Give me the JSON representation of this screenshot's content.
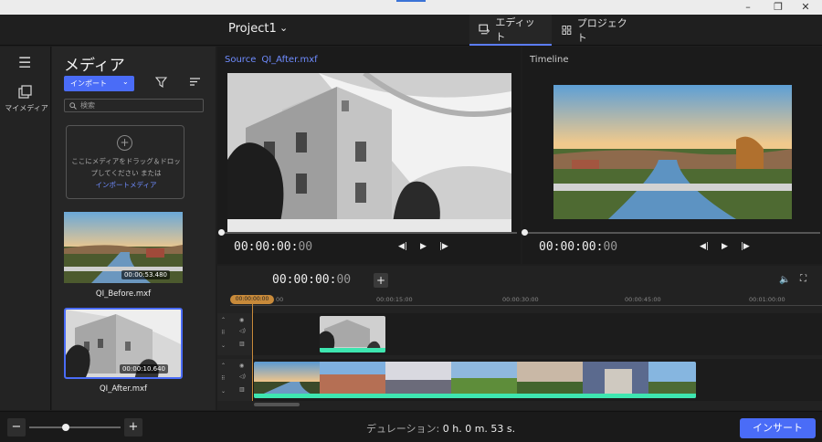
{
  "window": {
    "minimize": "–",
    "maximize": "❐",
    "close": "✕"
  },
  "header": {
    "project_title": "Project1",
    "project_chevron": "⌄",
    "tabs": [
      {
        "label": "エディット",
        "active": true
      },
      {
        "label": "プロジェクト",
        "active": false
      }
    ]
  },
  "rail": {
    "menu_glyph": "☰",
    "my_media_label": "マイメディア"
  },
  "media": {
    "title": "メディア",
    "import_label": "インポート",
    "search_placeholder": "検索",
    "dropzone_text": "ここにメディアをドラッグ＆ドロップしてください または",
    "dropzone_link": "インポートメディア",
    "items": [
      {
        "name": "QI_Before.mxf",
        "duration": "00:00:53.480",
        "selected": false
      },
      {
        "name": "QI_After.mxf",
        "duration": "00:00:10.640",
        "selected": true
      }
    ]
  },
  "source": {
    "label": "Source",
    "file": "QI_After.mxf",
    "timecode_main": "00:00:00:",
    "timecode_frames": "00"
  },
  "timeline_preview": {
    "label": "Timeline",
    "timecode_main": "00:00:00:",
    "timecode_frames": "00"
  },
  "timeline": {
    "timecode_main": "00:00:00:",
    "timecode_frames": "00",
    "playhead_label": "00:00:00:00",
    "ruler_ticks": [
      "00",
      "00:00:15:00",
      "00:00:30:00",
      "00:00:45:00",
      "00:01:00:00"
    ]
  },
  "bottom": {
    "zoom_minus": "−",
    "zoom_plus": "+",
    "duration_label": "デュレーション:",
    "duration_value": "0 h. 0 m. 53 s.",
    "insert_label": "インサート"
  },
  "colors": {
    "accent": "#4a6cf7",
    "clip_bar": "#3ee6b0",
    "playhead": "#c88a3a"
  }
}
